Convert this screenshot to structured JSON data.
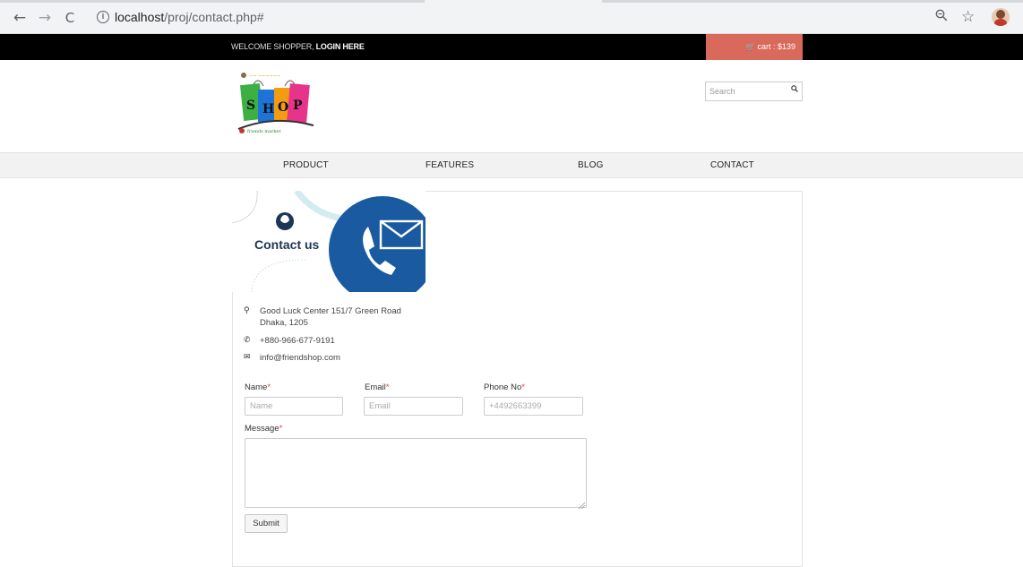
{
  "browser": {
    "url_host": "localhost",
    "url_path": "/proj/contact.php#",
    "back_icon": "←",
    "forward_icon": "→",
    "reload_icon": "C",
    "zoom_icon": "zoom-icon",
    "star_icon": "☆"
  },
  "topbar": {
    "welcome_text": "WELCOME SHOPPER, ",
    "login_label": "LOGIN HERE",
    "cart_label": "cart : $139",
    "cart_color": "#d9695a"
  },
  "header": {
    "logo_text": "SHOP",
    "logo_tagline": "friends market",
    "search_placeholder": "Search"
  },
  "menu": {
    "items": [
      {
        "label": "PRODUCT"
      },
      {
        "label": "FEATURES"
      },
      {
        "label": "BLOG"
      },
      {
        "label": "CONTACT"
      }
    ]
  },
  "banner": {
    "title": "Contact us",
    "accent_color": "#1a5aa0",
    "dark_color": "#1d3557"
  },
  "contact_info": {
    "address_line1": "Good Luck Center 151/7 Green Road",
    "address_line2": "Dhaka, 1205",
    "phone": "+880-966-677-9191",
    "email": "info@friendshop.com"
  },
  "form": {
    "name_label": "Name",
    "name_placeholder": "Name",
    "email_label": "Email",
    "email_placeholder": "Email",
    "phone_label": "Phone No",
    "phone_placeholder": "+4492663399",
    "message_label": "Message",
    "required_mark": "*",
    "submit_label": "Submit"
  }
}
